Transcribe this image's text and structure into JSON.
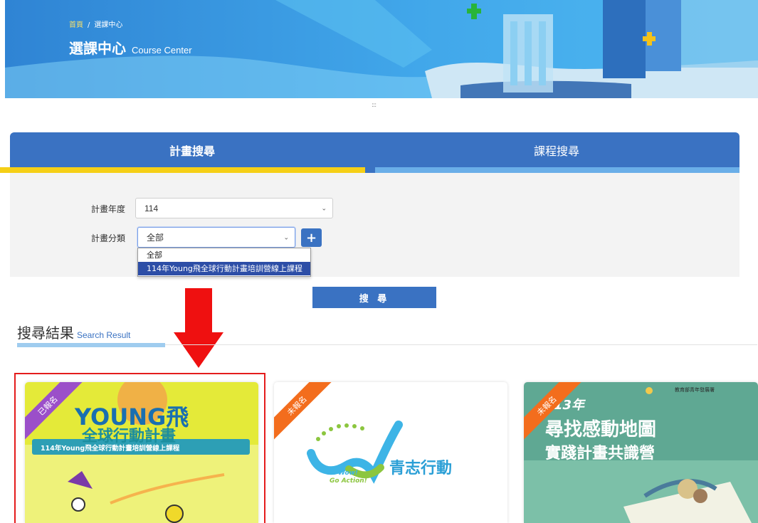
{
  "breadcrumb": {
    "home": "首頁",
    "separator": "/",
    "current": "選課中心"
  },
  "banner": {
    "title_zh": "選課中心",
    "title_en": "Course Center"
  },
  "drag_handle": ":::",
  "tabs": [
    {
      "label": "計畫搜尋",
      "active": true
    },
    {
      "label": "課程搜尋",
      "active": false
    }
  ],
  "form": {
    "year_label": "計畫年度",
    "year_value": "114",
    "category_label": "計畫分類",
    "category_value": "全部",
    "add_button": "+",
    "dropdown_options": [
      {
        "label": "全部",
        "highlighted": false
      },
      {
        "label": "114年Young飛全球行動計畫培訓營線上課程",
        "highlighted": true
      }
    ],
    "search_button": "搜 尋"
  },
  "results": {
    "title_zh": "搜尋結果",
    "title_en": "Search Result",
    "cards": [
      {
        "status": "已報名",
        "status_color": "#9b4fc9",
        "poster_line1": "YOUNG飛",
        "poster_line2": "全球行動計畫",
        "poster_line3": "114年Young飛全球行動計畫培訓營線上課程",
        "selected": true
      },
      {
        "status": "未報名",
        "status_color": "#f36d1d",
        "logo_text": "青志行動",
        "logo_sub1": "Wow!",
        "logo_sub2": "Go Action!"
      },
      {
        "status": "未報名",
        "status_color": "#f36d1d",
        "poster_year": "13年",
        "poster_line1": "尋找感動地圖",
        "poster_line2": "實踐計畫共識營",
        "poster_org": "教育部青年發展署"
      }
    ]
  },
  "colors": {
    "primary": "#3a72c2",
    "tab_active_bar": "#f5cf16",
    "tab_inactive_bar": "#6aaee8",
    "highlight": "#e41c1c"
  }
}
